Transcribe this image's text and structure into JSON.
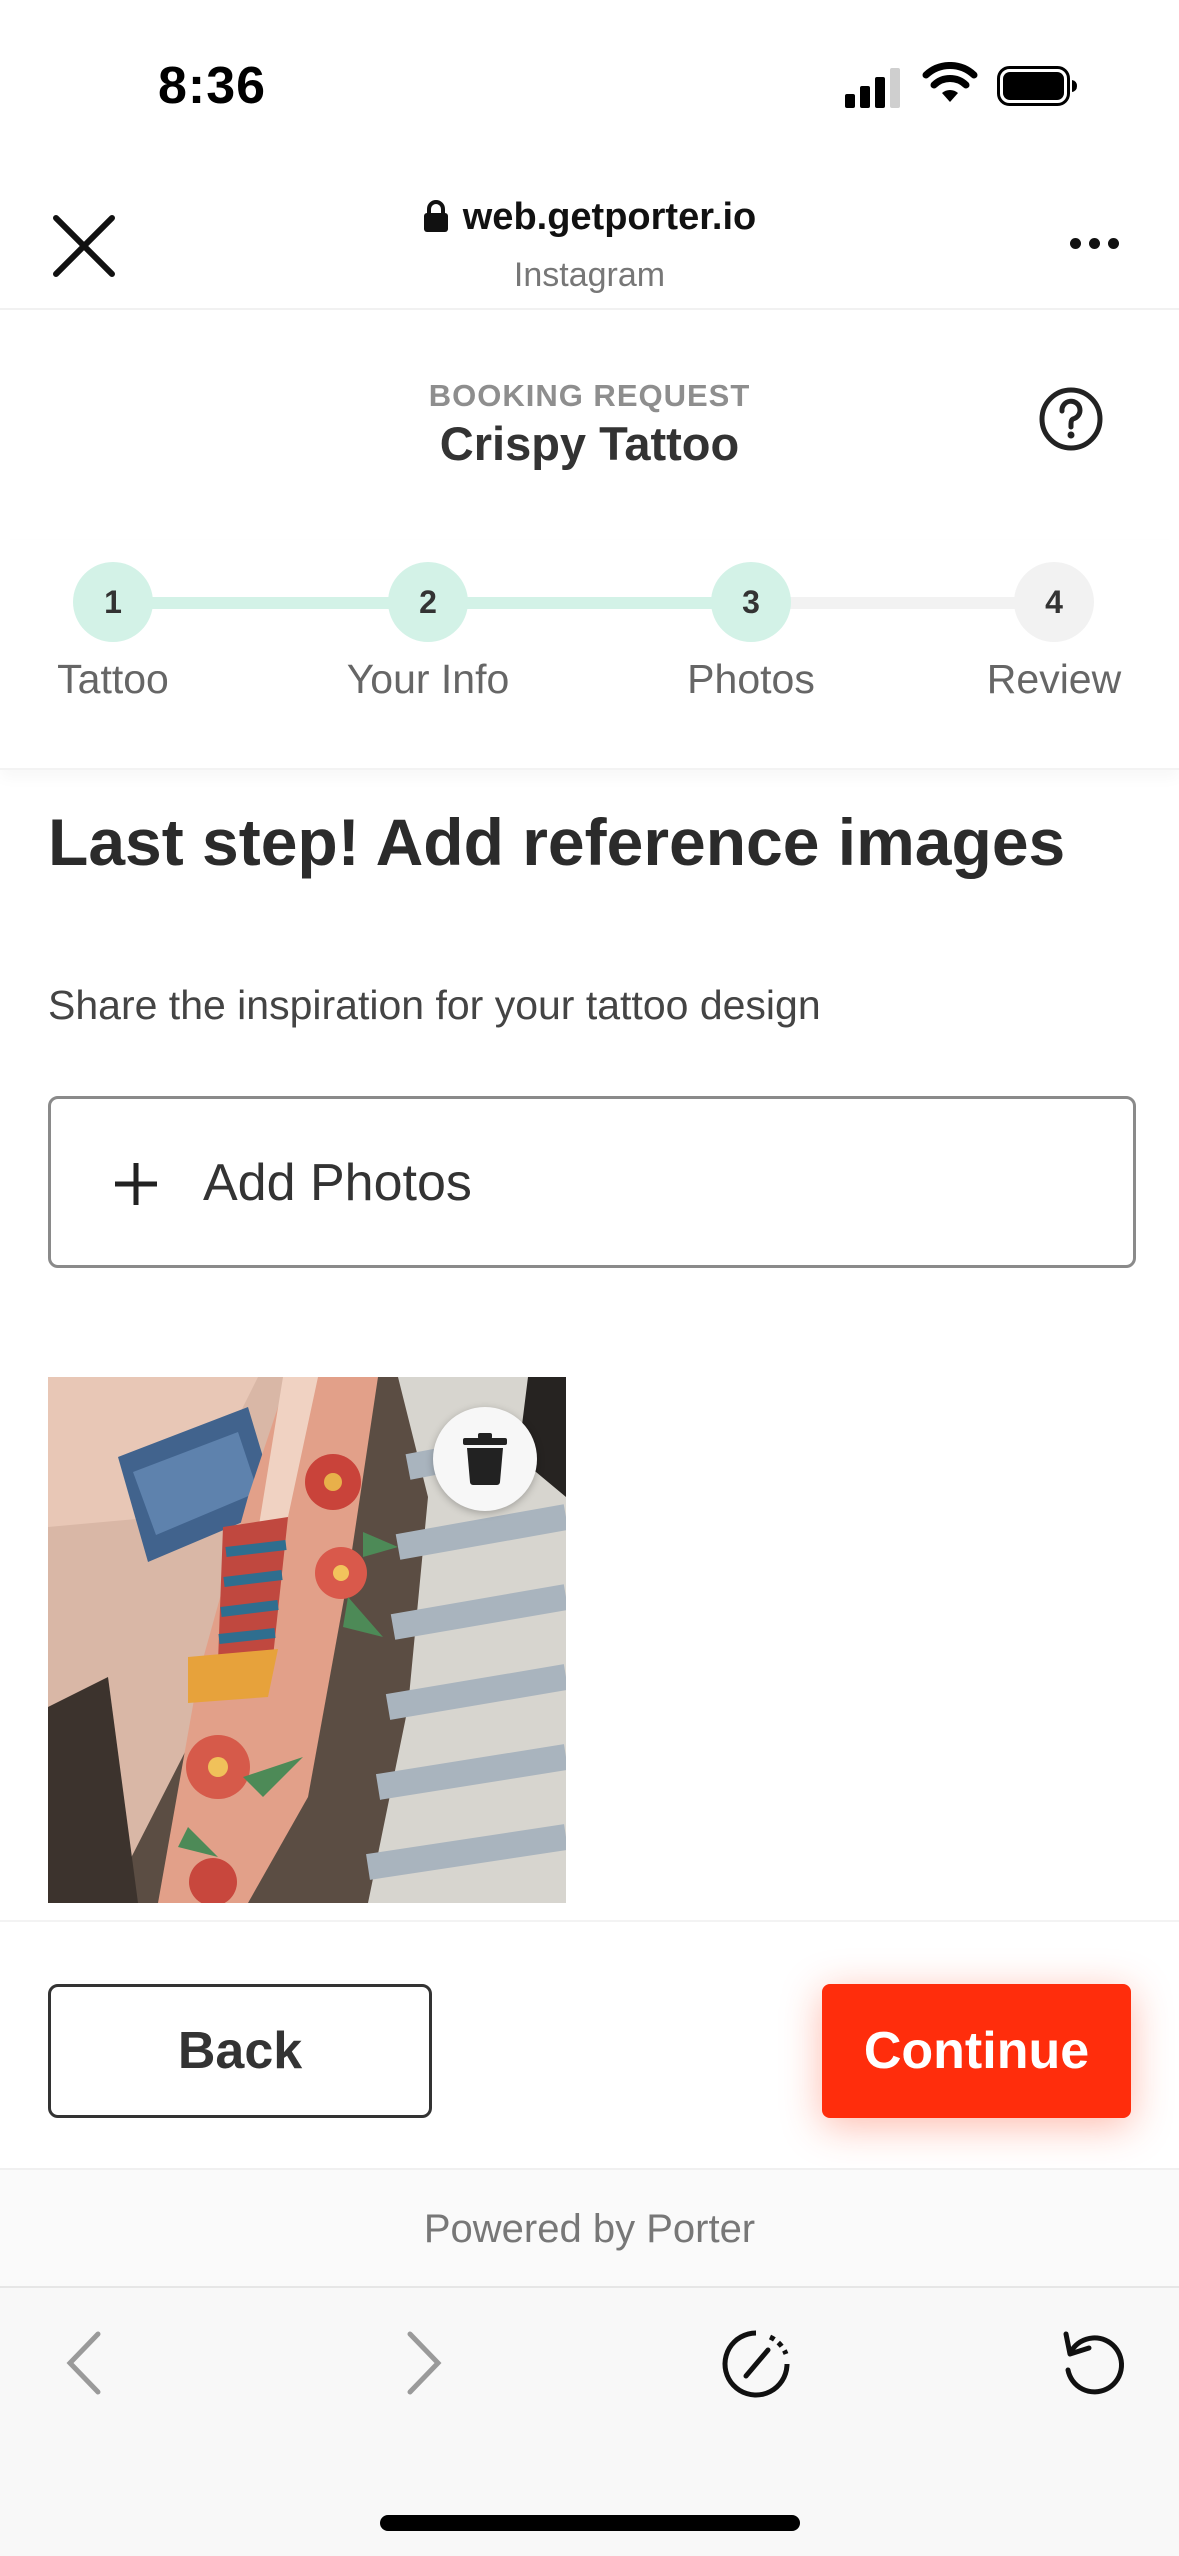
{
  "status_bar": {
    "time": "8:36"
  },
  "browser": {
    "url": "web.getporter.io",
    "source": "Instagram"
  },
  "header": {
    "label": "BOOKING REQUEST",
    "business_name": "Crispy Tattoo"
  },
  "stepper": {
    "steps": [
      {
        "number": "1",
        "label": "Tattoo",
        "state": "complete"
      },
      {
        "number": "2",
        "label": "Your Info",
        "state": "complete"
      },
      {
        "number": "3",
        "label": "Photos",
        "state": "current"
      },
      {
        "number": "4",
        "label": "Review",
        "state": "upcoming"
      }
    ],
    "complete_color": "#d3f2e7",
    "upcoming_color": "#f2f2f2"
  },
  "main": {
    "title": "Last step! Add reference images",
    "subtitle": "Share the inspiration for your tattoo design",
    "add_photos_label": "Add Photos",
    "photo_count": 1
  },
  "actions": {
    "back_label": "Back",
    "continue_label": "Continue",
    "continue_color": "#ff2d0c"
  },
  "footer": {
    "powered_by": "Powered by Porter"
  },
  "icons": {
    "status": [
      "signal-icon",
      "wifi-icon",
      "battery-icon"
    ],
    "browser_header": [
      "close-icon",
      "lock-icon",
      "more-icon"
    ],
    "page": [
      "help-icon",
      "plus-icon",
      "trash-icon"
    ],
    "toolbar": [
      "back-arrow-icon",
      "forward-arrow-icon",
      "speedometer-icon",
      "reload-icon"
    ]
  }
}
